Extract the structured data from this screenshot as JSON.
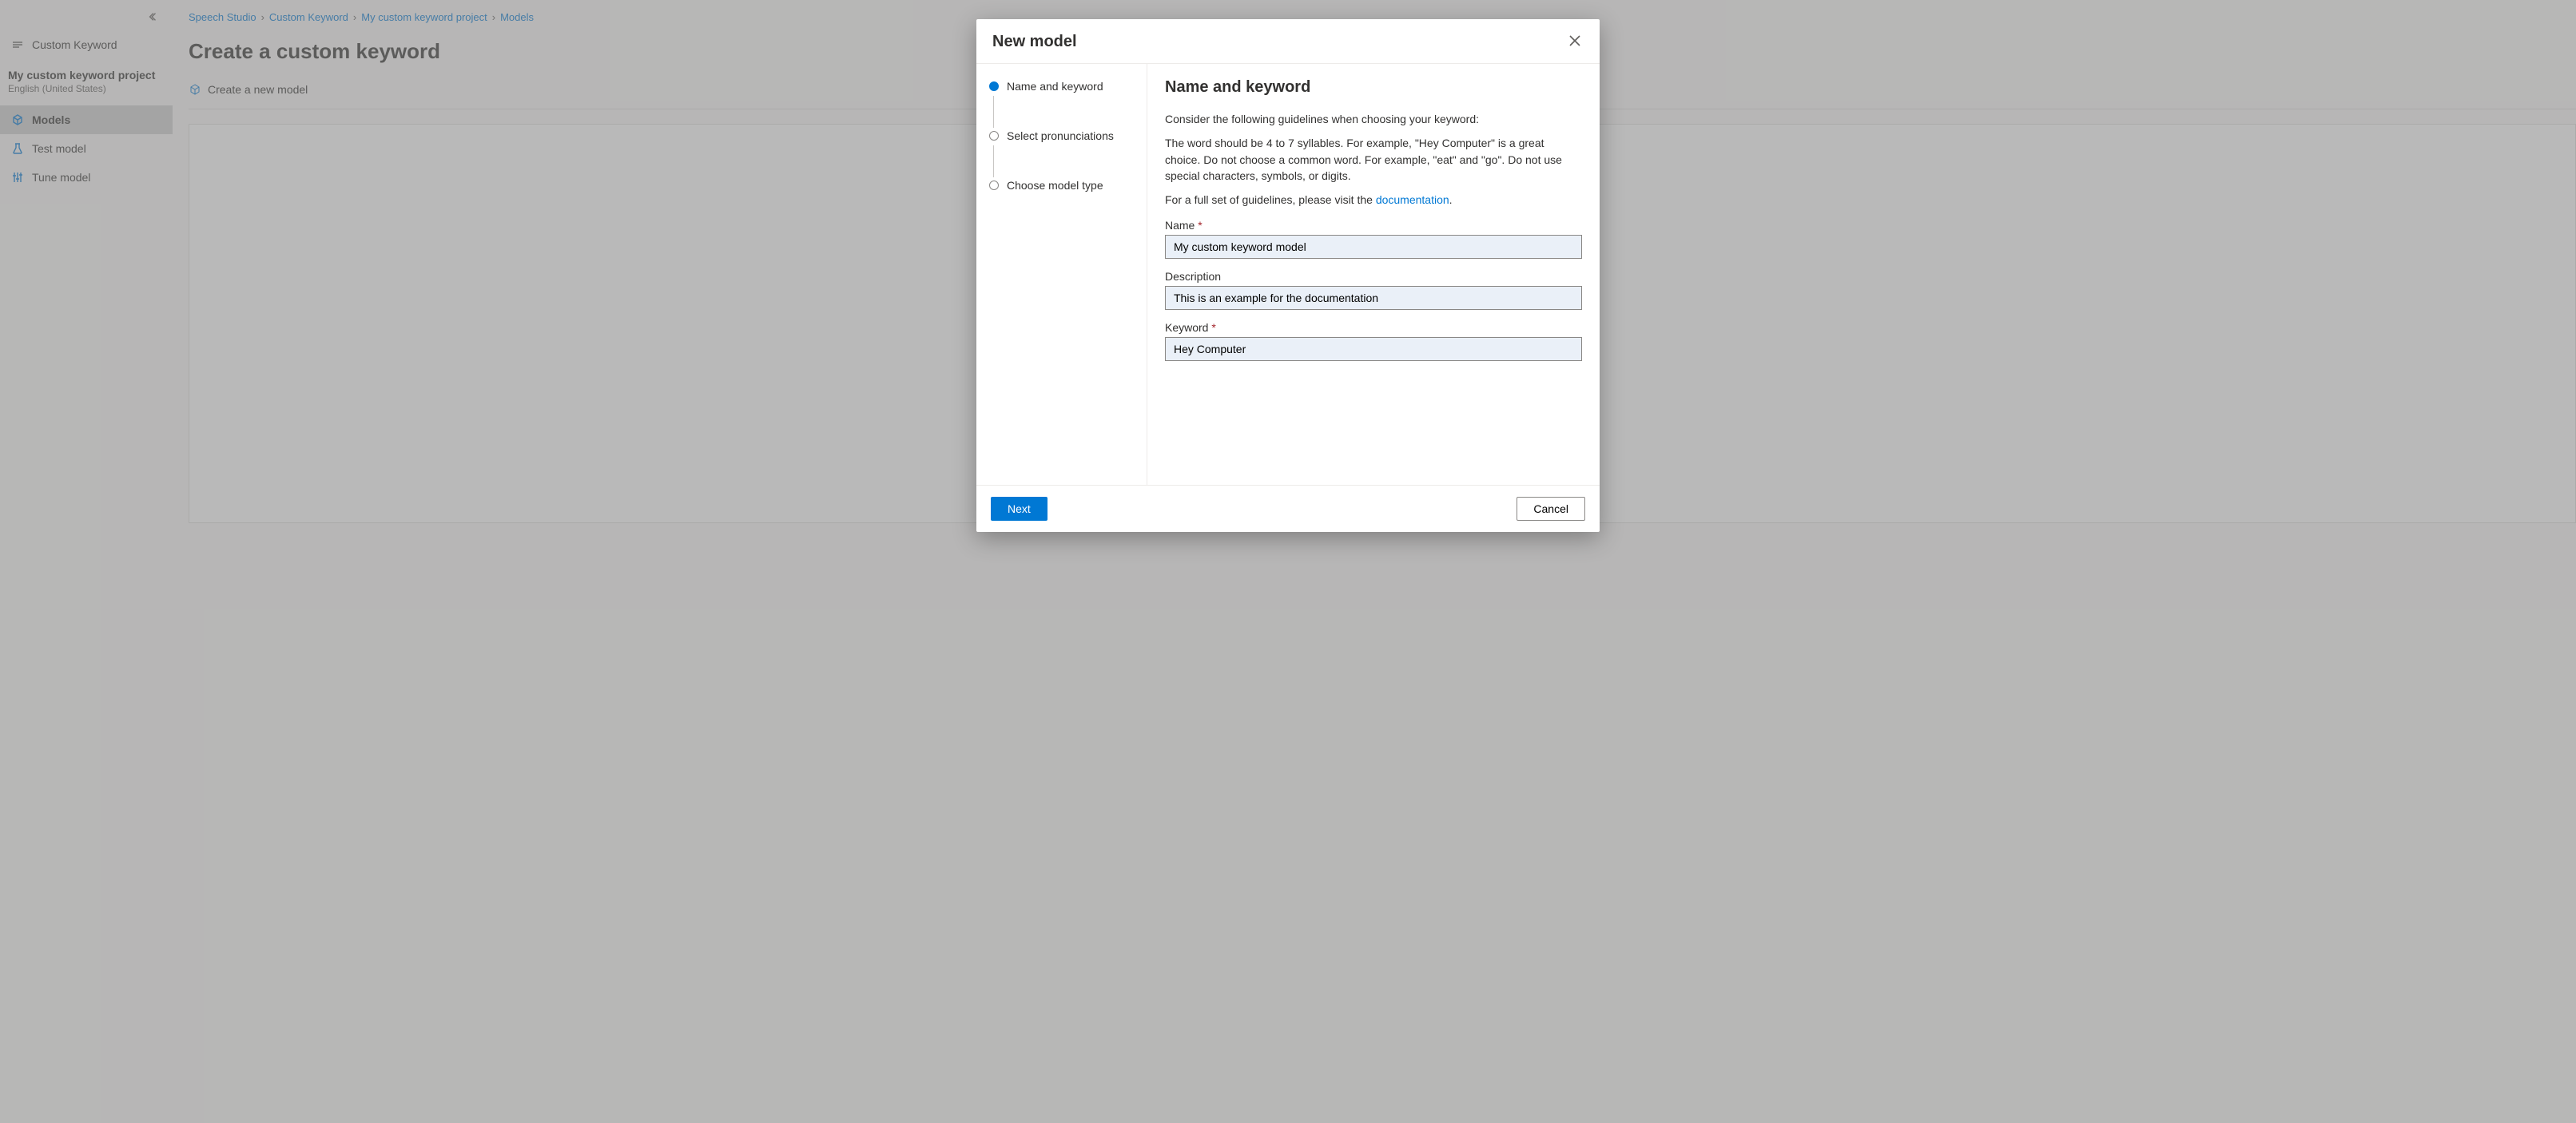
{
  "sidebar": {
    "category_label": "Custom Keyword",
    "project_name": "My custom keyword project",
    "project_lang": "English (United States)",
    "items": [
      {
        "label": "Models"
      },
      {
        "label": "Test model"
      },
      {
        "label": "Tune model"
      }
    ]
  },
  "breadcrumbs": [
    "Speech Studio",
    "Custom Keyword",
    "My custom keyword project",
    "Models"
  ],
  "page_title": "Create a custom keyword",
  "toolbar": {
    "create_label": "Create a new model"
  },
  "modal": {
    "title": "New model",
    "steps": [
      "Name and keyword",
      "Select pronunciations",
      "Choose model type"
    ],
    "panel_heading": "Name and keyword",
    "guideline_intro": "Consider the following guidelines when choosing your keyword:",
    "guideline_body": "The word should be 4 to 7 syllables. For example, \"Hey Computer\" is a great choice. Do not choose a common word. For example, \"eat\" and \"go\". Do not use special characters, symbols, or digits.",
    "doc_prefix": "For a full set of guidelines, please visit the ",
    "doc_link_text": "documentation",
    "name_label": "Name",
    "name_value": "My custom keyword model",
    "desc_label": "Description",
    "desc_value": "This is an example for the documentation",
    "keyword_label": "Keyword",
    "keyword_value": "Hey Computer",
    "next_label": "Next",
    "cancel_label": "Cancel"
  }
}
